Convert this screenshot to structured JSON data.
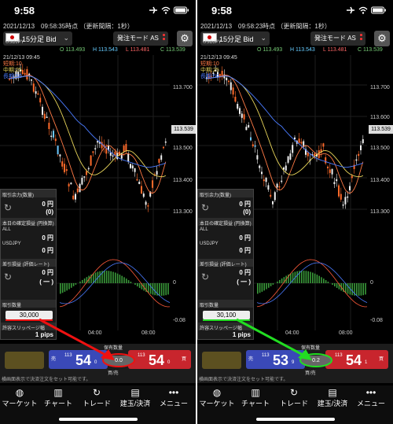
{
  "colors": {
    "green_arrow": "#22dd22",
    "red_arrow": "#ee1111",
    "sell": "#3a49b8",
    "buy": "#c8252d"
  },
  "panels": [
    {
      "status_time": "9:58",
      "info_bar": "2021/12/13　09:58:35時点 （更新間隔：1秒）",
      "symbol": "USDJPY",
      "timeframe": "15分足 Bid",
      "order_mode": "発注モード AS",
      "ohlc": {
        "o": "O 113.493",
        "h": "H 113.543",
        "l": "L 113.481",
        "c": "C 113.539"
      },
      "timestamp": "21/12/13 09:45",
      "ma": {
        "short": "短期:10",
        "mid": "中期:25",
        "long": "長期:50"
      },
      "y_ticks": [
        "113.700",
        "113.500",
        "113.400",
        "113.300",
        "0",
        "-0.08"
      ],
      "price_tag": "113.539",
      "x_ticks": [
        "04:00",
        "08:00"
      ],
      "account": {
        "available_label": "取引余力(数量)",
        "available_1": "0 円",
        "available_2": "(0)",
        "fixed_label": "本日の確定損益 (円換算)",
        "fixed_all": "ALL",
        "fixed_value": "0 円",
        "pair": "USDJPY",
        "pair_value": "0 円",
        "unreal_label": "差引損益 (評価レート)",
        "unreal_value": "0 円",
        "unreal_rate": "( 一 )",
        "qty_label": "取引数量",
        "qty_value": "30,000",
        "slip_label": "許容スリッページ幅",
        "slip_value": "1 pips"
      },
      "order": {
        "lock_label": "",
        "position_label": "保有数量",
        "sell_label": "売",
        "sell_small": "113",
        "sell_big": "54",
        "sell_tail": "0",
        "spread": "0.0",
        "spread_label": "買/売",
        "buy_label": "買",
        "buy_small": "113",
        "buy_big": "54",
        "buy_tail": "0",
        "lock_hint": "横画面表示で決済注文をセット可能です。"
      },
      "arrow_color": "#ee1111"
    },
    {
      "status_time": "9:58",
      "info_bar": "2021/12/13　09:58:23時点 （更新間隔：1秒）",
      "symbol": "USDJPY",
      "timeframe": "15分足 Bid",
      "order_mode": "発注モード AS",
      "ohlc": {
        "o": "O 113.493",
        "h": "H 113.543",
        "l": "L 113.481",
        "c": "C 113.539"
      },
      "timestamp": "21/12/13 09:45",
      "ma": {
        "short": "短期:10",
        "mid": "中期:25",
        "long": "長期:50"
      },
      "y_ticks": [
        "113.700",
        "113.600",
        "113.500",
        "113.400",
        "113.300",
        "0",
        "-0.08"
      ],
      "price_tag": "113.539",
      "x_ticks": [
        "04:00",
        "08:00"
      ],
      "account": {
        "available_label": "取引余力(数量)",
        "available_1": "0 円",
        "available_2": "(0)",
        "fixed_label": "本日の確定損益 (円換算)",
        "fixed_all": "ALL",
        "fixed_value": "0 円",
        "pair": "USDJPY",
        "pair_value": "0 円",
        "unreal_label": "差引損益 (評価レート)",
        "unreal_value": "0 円",
        "unreal_rate": "( 一 )",
        "qty_label": "取引数量",
        "qty_value": "30,100",
        "slip_label": "許容スリッページ幅",
        "slip_value": "1 pips"
      },
      "order": {
        "lock_label": "",
        "position_label": "保有数量",
        "sell_label": "売",
        "sell_small": "113",
        "sell_big": "53",
        "sell_tail": "9",
        "spread": "0.2",
        "spread_label": "買/売",
        "buy_label": "買",
        "buy_small": "113",
        "buy_big": "54",
        "buy_tail": "1",
        "lock_hint": "横画面表示で決済注文をセット可能です。"
      },
      "arrow_color": "#22dd22"
    }
  ],
  "tabs": [
    {
      "label": "マーケット",
      "icon": "globe-icon"
    },
    {
      "label": "チャート",
      "icon": "chart-icon"
    },
    {
      "label": "トレード",
      "icon": "trade-icon"
    },
    {
      "label": "建玉/決済",
      "icon": "position-icon"
    },
    {
      "label": "メニュー",
      "icon": "menu-icon"
    }
  ]
}
